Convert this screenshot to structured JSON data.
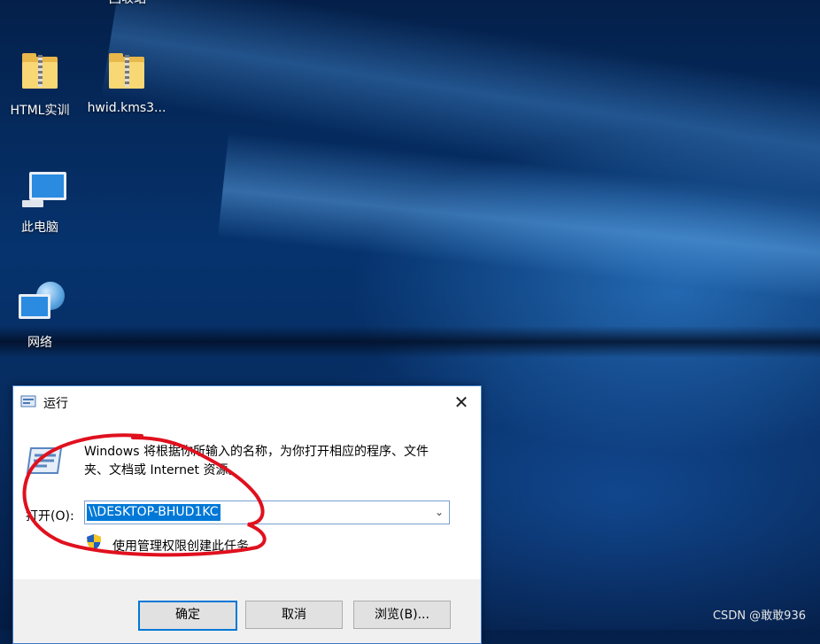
{
  "desktop": {
    "icons": [
      {
        "label": "回收站"
      },
      {
        "label": "HTML实训"
      },
      {
        "label": "hwid.kms3..."
      },
      {
        "label": "此电脑"
      },
      {
        "label": "网络"
      }
    ]
  },
  "run_dialog": {
    "title": "运行",
    "close_symbol": "✕",
    "description": "Windows 将根据你所输入的名称，为你打开相应的程序、文件夹、文档或 Internet 资源。",
    "open_label": "打开(O):",
    "open_value": "\\\\DESKTOP-BHUD1KC",
    "dropdown_symbol": "⌄",
    "admin_text": "使用管理权限创建此任务",
    "buttons": {
      "ok": "确定",
      "cancel": "取消",
      "browse": "浏览(B)..."
    }
  },
  "watermark": "CSDN @敢敢936",
  "colors": {
    "accent": "#0078d7",
    "annotation": "#e0101e",
    "folder": "#f8d775"
  },
  "icons": [
    "recycle-bin-icon",
    "folder-zip-icon",
    "this-pc-icon",
    "network-icon",
    "run-icon",
    "uac-shield-icon"
  ]
}
